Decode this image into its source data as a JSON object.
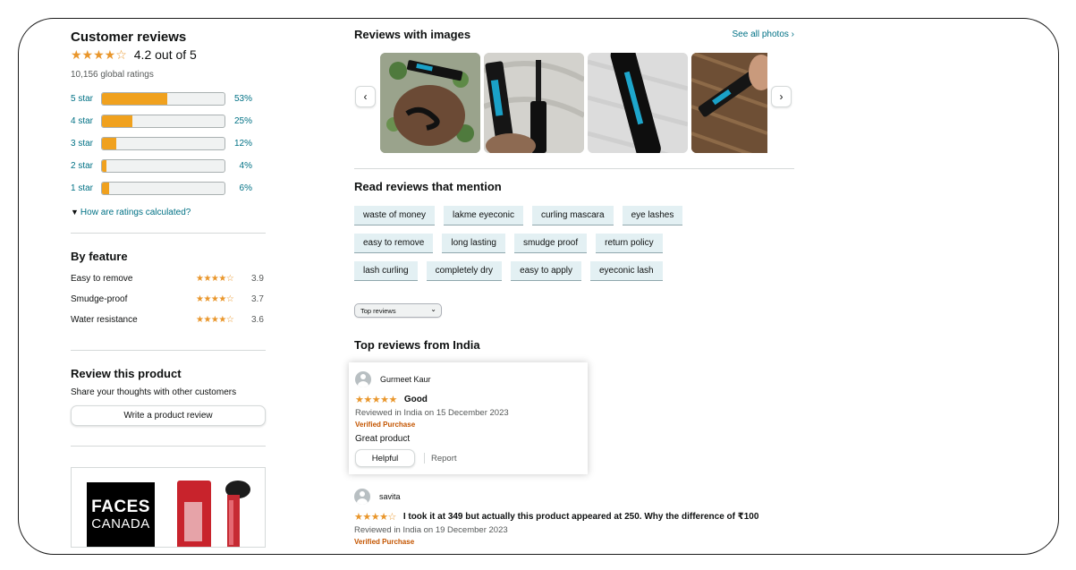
{
  "ratings": {
    "title": "Customer reviews",
    "average_stars": "★★★★☆",
    "average_value": 4.2,
    "average_text": "4.2 out of 5",
    "global_ratings": "10,156 global ratings",
    "histogram": [
      {
        "label": "5 star",
        "percent_text": "53%",
        "fraction": 0.53
      },
      {
        "label": "4 star",
        "percent_text": "25%",
        "fraction": 0.25
      },
      {
        "label": "3 star",
        "percent_text": "12%",
        "fraction": 0.12
      },
      {
        "label": "2 star",
        "percent_text": "4%",
        "fraction": 0.04
      },
      {
        "label": "1 star",
        "percent_text": "6%",
        "fraction": 0.06
      }
    ],
    "how_calculated": "How are ratings calculated?"
  },
  "by_feature": {
    "title": "By feature",
    "items": [
      {
        "name": "Easy to remove",
        "stars": "★★★★☆",
        "value": "3.9"
      },
      {
        "name": "Smudge-proof",
        "stars": "★★★★☆",
        "value": "3.7"
      },
      {
        "name": "Water resistance",
        "stars": "★★★★☆",
        "value": "3.6"
      }
    ]
  },
  "review_product": {
    "title": "Review this product",
    "subtitle": "Share your thoughts with other customers",
    "button": "Write a product review"
  },
  "ad": {
    "brand_line1": "FACES",
    "brand_line2": "CANADA"
  },
  "images_section": {
    "title": "Reviews with images",
    "see_all": "See all photos ›",
    "prev_arrow": "‹",
    "next_arrow": "›"
  },
  "mentions": {
    "title": "Read reviews that mention",
    "rows": [
      [
        "waste of money",
        "lakme eyeconic",
        "curling mascara",
        "eye lashes"
      ],
      [
        "easy to remove",
        "long lasting",
        "smudge proof",
        "return policy"
      ],
      [
        "lash curling",
        "completely dry",
        "easy to apply",
        "eyeconic lash"
      ]
    ]
  },
  "sort": {
    "selected": "Top reviews",
    "caret": "⌄"
  },
  "top_reviews": {
    "title": "Top reviews from India",
    "reviews": [
      {
        "name": "Gurmeet Kaur",
        "stars": "★★★★★",
        "headline": "Good",
        "date": "Reviewed in India on 15 December 2023",
        "verified": "Verified Purchase",
        "body": "Great product",
        "helpful": "Helpful",
        "report": "Report"
      },
      {
        "name": "savita",
        "stars": "★★★★☆",
        "headline": "I took it at 349 but actually this product appeared at 250. Why the difference of ₹100",
        "date": "Reviewed in India on 19 December 2023",
        "verified": "Verified Purchase"
      }
    ]
  },
  "colors": {
    "star": "#e9962b",
    "bar_fill": "#f0a11e",
    "link": "#007185",
    "verified": "#c45500",
    "chip_bg": "#e3f0f3"
  }
}
